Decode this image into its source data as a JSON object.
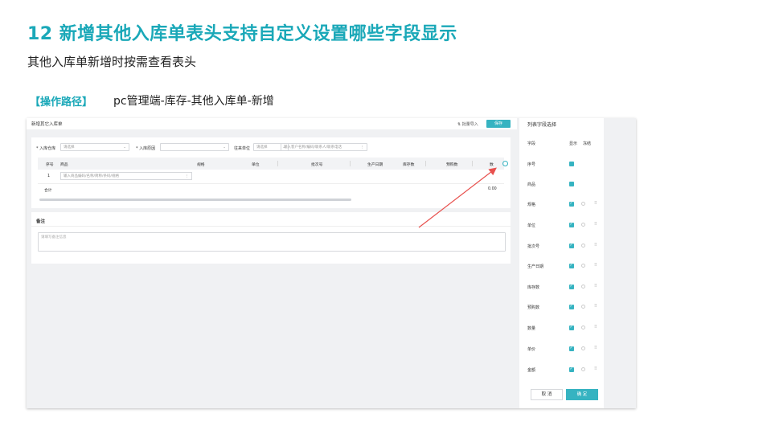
{
  "slide": {
    "title": "12  新增其他入库单表头支持自定义设置哪些字段显示",
    "subtitle": "其他入库单新增时按需查看表头",
    "path_label": "【操作路径】",
    "path_text": "pc管理端-库存-其他入库单-新增"
  },
  "app": {
    "page_name": "新增其它入库单",
    "import_label": "批量导入",
    "save_label": "保存",
    "warehouse_label": "* 入库仓库",
    "warehouse_placeholder": "请选择",
    "reason_label": "* 入库原因",
    "reason_value": "",
    "partner_label": "往来单位",
    "partner_type": "请选择",
    "partner_placeholder": "输入客户名称/编码/联系人/联系电话",
    "table_headers": [
      "序号",
      "商品",
      "规格",
      "单位",
      "批次号",
      "生产日期",
      "库存数",
      "预购数",
      "数"
    ],
    "row_index": "1",
    "goods_placeholder": "输入商品编码/名称/简称/条码/规格",
    "total_label": "合计",
    "total_value": "0.00",
    "remark_title": "备注",
    "remark_placeholder": "请填写备注信息"
  },
  "panel": {
    "title": "列表字段选择",
    "col_field": "字段",
    "col_show": "显示",
    "col_freeze": "冻结",
    "fields": [
      "序号",
      "商品",
      "规格",
      "单位",
      "批次号",
      "生产日期",
      "库存数",
      "预购数",
      "数量",
      "单价",
      "金额"
    ],
    "cancel_label": "取 消",
    "ok_label": "确 定"
  },
  "colors": {
    "accent": "#1aa8b8",
    "button": "#36b3c1",
    "arrow": "#e8514e"
  }
}
